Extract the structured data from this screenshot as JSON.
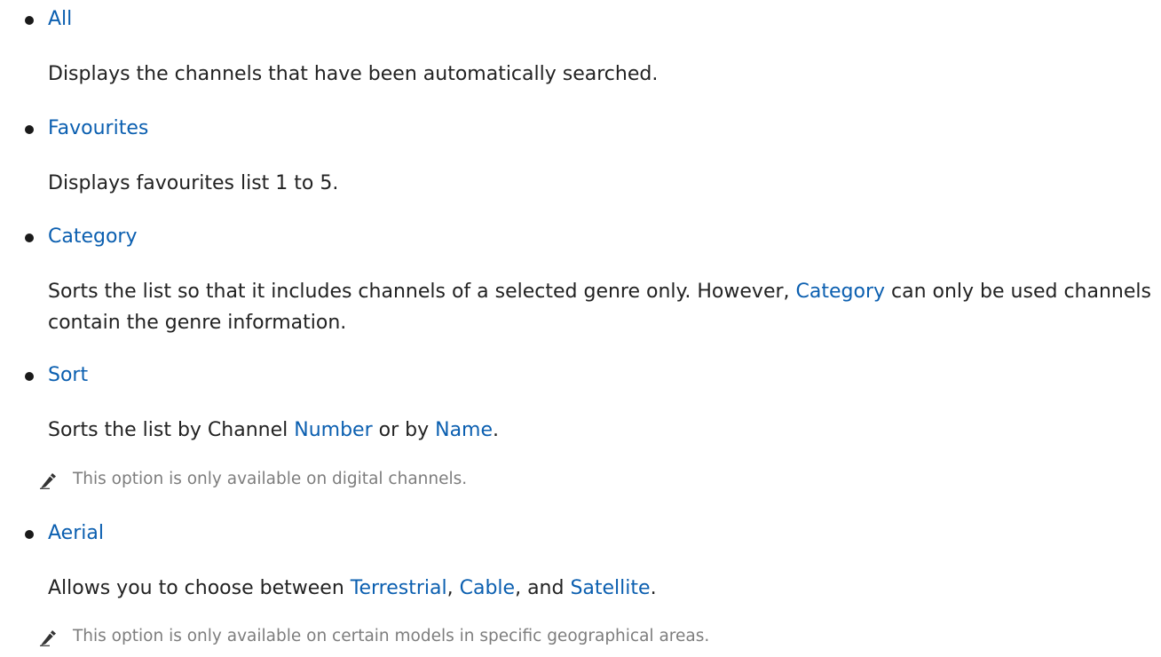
{
  "items": [
    {
      "term": "All",
      "description": "Displays the channels that have been automatically searched."
    },
    {
      "term": "Favourites",
      "description": "Displays favourites list 1 to 5."
    },
    {
      "term": "Category",
      "description_part1": "Sorts the list so that it includes channels of a selected genre only. However, ",
      "description_link": "Category",
      "description_part2": " can only be used channels contain the genre information."
    },
    {
      "term": "Sort",
      "description_part1": "Sorts the list by Channel ",
      "description_link1": "Number",
      "description_part2": " or by ",
      "description_link2": "Name",
      "description_part3": ".",
      "note": "This option is only available on digital channels."
    },
    {
      "term": "Aerial",
      "description_part1": "Allows you to choose between ",
      "description_link1": "Terrestrial",
      "description_part2": ", ",
      "description_link2": "Cable",
      "description_part3": ", and ",
      "description_link3": "Satellite",
      "description_part4": ".",
      "note": "This option is only available on certain models in specific geographical areas."
    }
  ],
  "colors": {
    "link": "#0b5fb0",
    "text": "#222222",
    "note": "#7d7d7d"
  },
  "icons": {
    "note": "pencil-icon"
  }
}
